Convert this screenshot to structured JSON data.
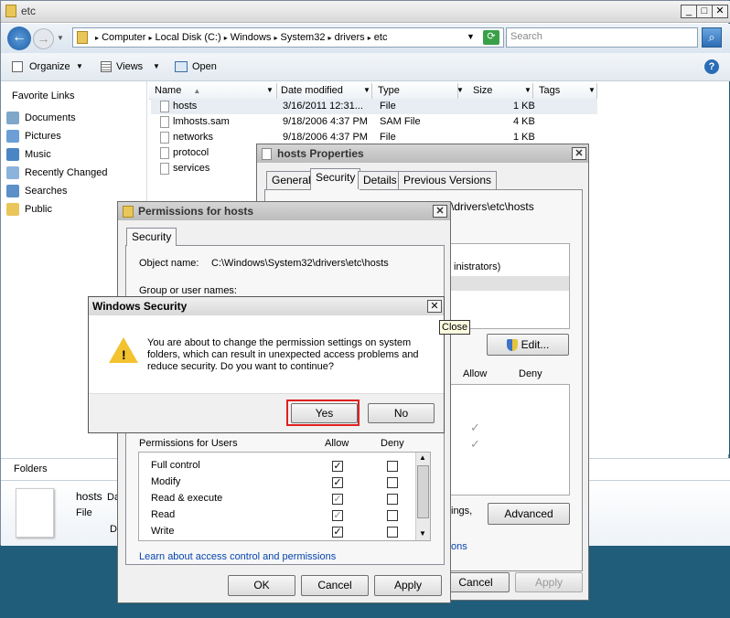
{
  "window": {
    "title": "etc",
    "minimize": "_",
    "maximize": "□",
    "close": "✕"
  },
  "address": {
    "segments": [
      "Computer",
      "Local Disk (C:)",
      "Windows",
      "System32",
      "drivers",
      "etc"
    ],
    "search_placeholder": "Search"
  },
  "toolbar": {
    "organize": "Organize",
    "views": "Views",
    "open": "Open",
    "help": "?"
  },
  "nav": {
    "header": "Favorite Links",
    "items": [
      "Documents",
      "Pictures",
      "Music",
      "Recently Changed",
      "Searches",
      "Public"
    ]
  },
  "columns": [
    "Name",
    "Date modified",
    "Type",
    "Size",
    "Tags"
  ],
  "files": [
    {
      "name": "hosts",
      "date": "3/16/2011 12:31...",
      "type": "File",
      "size": "1 KB"
    },
    {
      "name": "lmhosts.sam",
      "date": "9/18/2006 4:37 PM",
      "type": "SAM File",
      "size": "4 KB"
    },
    {
      "name": "networks",
      "date": "9/18/2006 4:37 PM",
      "type": "File",
      "size": "1 KB"
    },
    {
      "name": "protocol",
      "date": "",
      "type": "",
      "size": ""
    },
    {
      "name": "services",
      "date": "",
      "type": "",
      "size": ""
    }
  ],
  "folders_label": "Folders",
  "details": {
    "name": "hosts",
    "name_trail": "Da",
    "type": "File",
    "extra": "D"
  },
  "props": {
    "title": "hosts Properties",
    "tabs": [
      "General",
      "Security",
      "Details",
      "Previous Versions"
    ],
    "path_fragment": "\\drivers\\etc\\hosts",
    "group_fragment": "inistrators)",
    "edit": "Edit...",
    "allow": "Allow",
    "deny": "Deny",
    "settings_fragment": "ings,",
    "advanced": "Advanced",
    "link_fragment": "ons",
    "cancel": "Cancel",
    "apply": "Apply"
  },
  "perm": {
    "title": "Permissions for hosts",
    "tab": "Security",
    "object_label": "Object name:",
    "object_value": "C:\\Windows\\System32\\drivers\\etc\\hosts",
    "group_label": "Group or user names:",
    "perm_header": "Permissions for Users",
    "allow": "Allow",
    "deny": "Deny",
    "rows": [
      {
        "name": "Full control",
        "allow": true,
        "deny": false
      },
      {
        "name": "Modify",
        "allow": true,
        "deny": false
      },
      {
        "name": "Read & execute",
        "allow": true,
        "deny": false
      },
      {
        "name": "Read",
        "allow": true,
        "deny": false
      },
      {
        "name": "Write",
        "allow": true,
        "deny": false
      }
    ],
    "link": "Learn about access control and permissions",
    "ok": "OK",
    "cancel": "Cancel",
    "apply": "Apply"
  },
  "security": {
    "title": "Windows Security",
    "message": "You are about to change the permission settings on system folders, which can result in unexpected access problems and reduce security. Do you want to continue?",
    "yes": "Yes",
    "no": "No",
    "close_tooltip": "Close"
  },
  "colors": {
    "accent": "#1f5d7a",
    "highlight_border": "#e02020"
  }
}
